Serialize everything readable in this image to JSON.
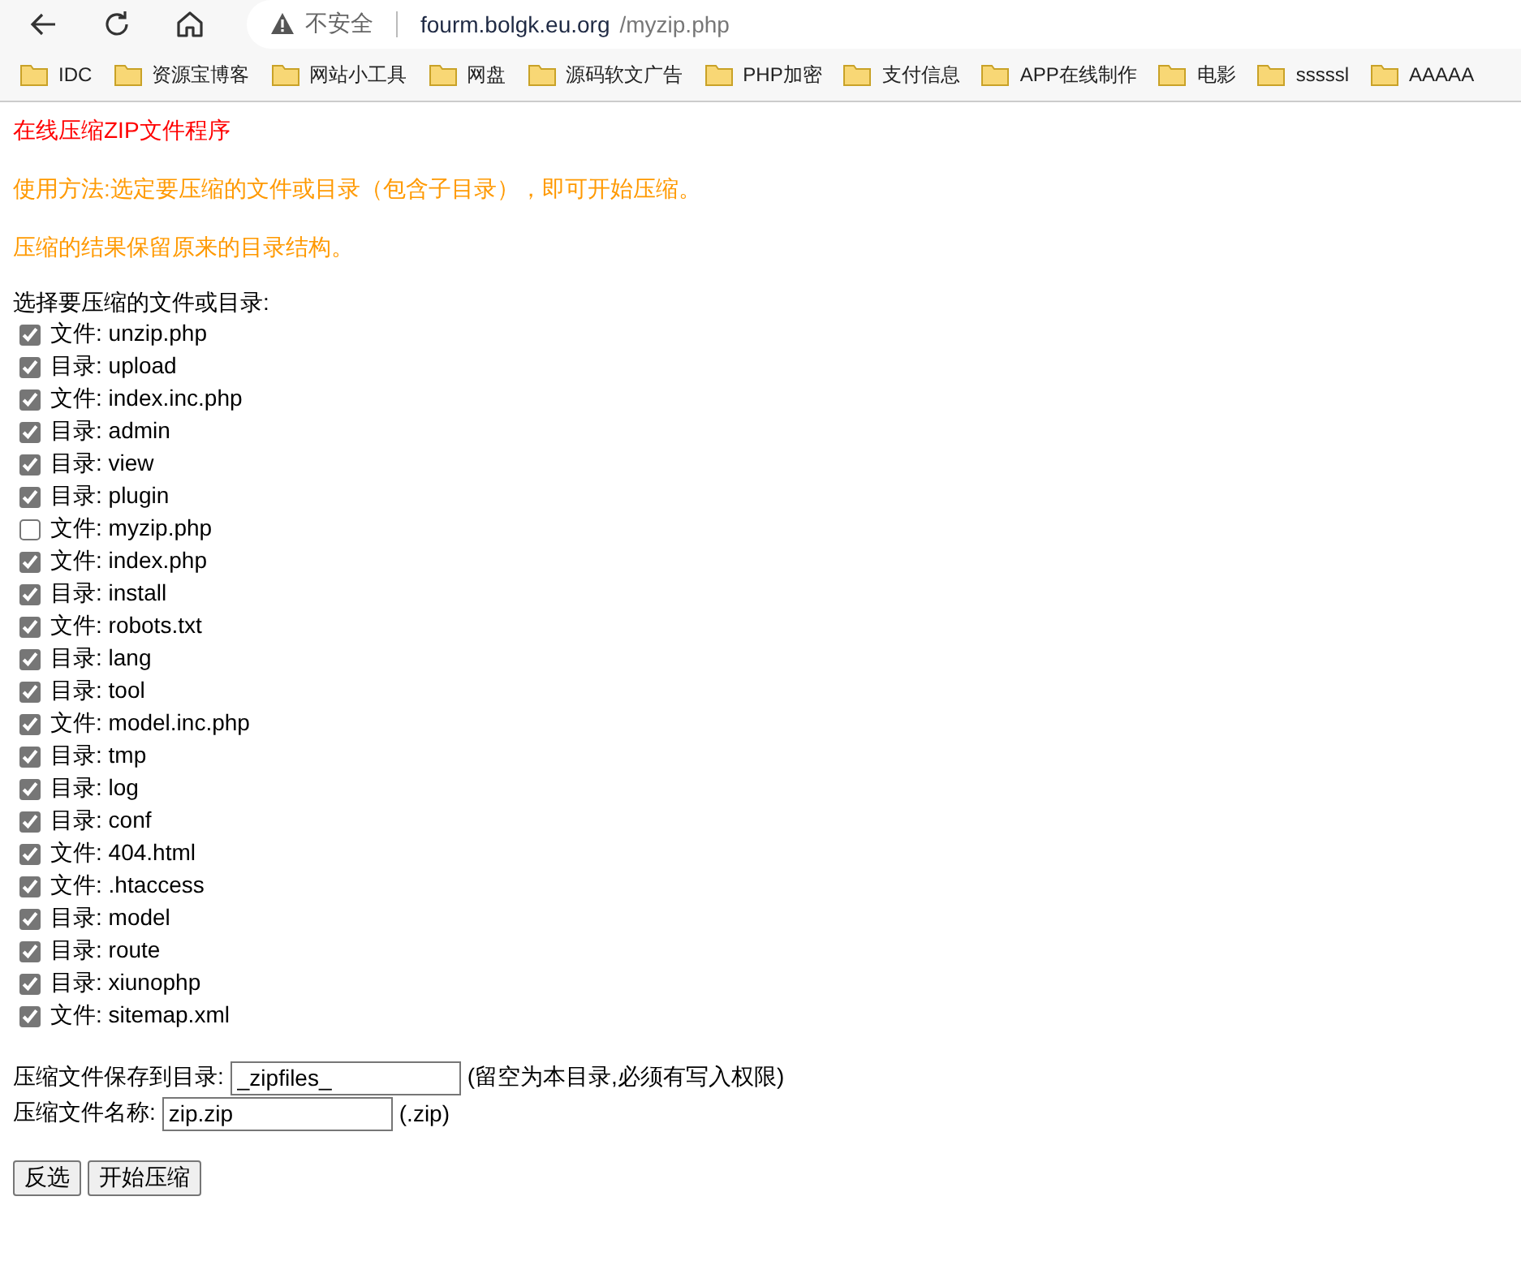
{
  "browser": {
    "security_label": "不安全",
    "url_host": "fourm.bolgk.eu.org",
    "url_path": "/myzip.php"
  },
  "bookmarks": [
    "IDC",
    "资源宝博客",
    "网站小工具",
    "网盘",
    "源码软文广告",
    "PHP加密",
    "支付信息",
    "APP在线制作",
    "电影",
    "sssssl",
    "AAAAA"
  ],
  "page": {
    "title": "在线压缩ZIP文件程序",
    "usage": "使用方法:选定要压缩的文件或目录（包含子目录），即可开始压缩。",
    "note": "压缩的结果保留原来的目录结构。",
    "select_label": "选择要压缩的文件或目录:",
    "items": [
      {
        "label": "文件: unzip.php",
        "checked": true
      },
      {
        "label": "目录: upload",
        "checked": true
      },
      {
        "label": "文件: index.inc.php",
        "checked": true
      },
      {
        "label": "目录: admin",
        "checked": true
      },
      {
        "label": "目录: view",
        "checked": true
      },
      {
        "label": "目录: plugin",
        "checked": true
      },
      {
        "label": "文件: myzip.php",
        "checked": false
      },
      {
        "label": "文件: index.php",
        "checked": true
      },
      {
        "label": "目录: install",
        "checked": true
      },
      {
        "label": "文件: robots.txt",
        "checked": true
      },
      {
        "label": "目录: lang",
        "checked": true
      },
      {
        "label": "目录: tool",
        "checked": true
      },
      {
        "label": "文件: model.inc.php",
        "checked": true
      },
      {
        "label": "目录: tmp",
        "checked": true
      },
      {
        "label": "目录: log",
        "checked": true
      },
      {
        "label": "目录: conf",
        "checked": true
      },
      {
        "label": "文件: 404.html",
        "checked": true
      },
      {
        "label": "文件: .htaccess",
        "checked": true
      },
      {
        "label": "目录: model",
        "checked": true
      },
      {
        "label": "目录: route",
        "checked": true
      },
      {
        "label": "目录: xiunophp",
        "checked": true
      },
      {
        "label": "文件: sitemap.xml",
        "checked": true
      }
    ],
    "save_dir": {
      "label": "压缩文件保存到目录:",
      "value": "_zipfiles_",
      "hint": "(留空为本目录,必须有写入权限)"
    },
    "file_name": {
      "label": "压缩文件名称:",
      "value": "zip.zip",
      "hint": "(.zip)"
    },
    "buttons": [
      "反选",
      "开始压缩"
    ]
  }
}
